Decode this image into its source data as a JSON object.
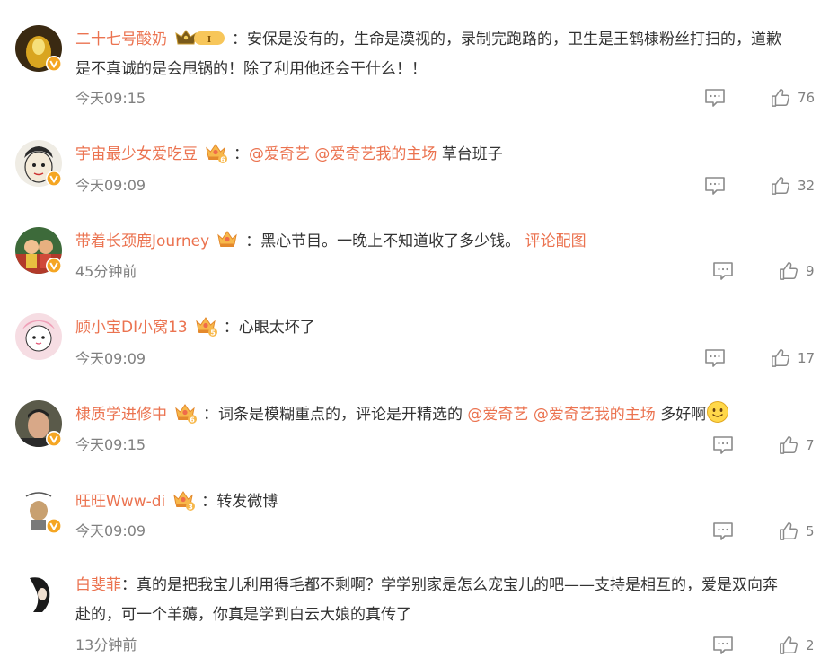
{
  "comments": [
    {
      "username": "二十七号酸奶",
      "separator": "：",
      "text": "安保是没有的，生命是漠视的，录制完跑路的，卫生是王鹤棣粉丝打扫的，道歉是不真诚的是会甩锅的！除了利用他还会干什么！！",
      "line1": "安保是没有的，生命是漠视的，录制完跑路的，卫生是王鹤棣粉丝打扫的，道歉",
      "line2": "是不真诚的是会甩锅的！除了利用他还会干什么！！",
      "time": "今天09:15",
      "likes": "76",
      "medal_level": "I"
    },
    {
      "username": "宇宙最少女爱吃豆",
      "separator": "：",
      "mentions": [
        "@爱奇艺",
        "@爱奇艺我的主场"
      ],
      "text": "草台班子",
      "time": "今天09:09",
      "likes": "32",
      "medal_level": "6"
    },
    {
      "username": "带着长颈鹿Journey",
      "separator": "：",
      "text": "黑心节目。一晚上不知道收了多少钱。",
      "picture_link": "评论配图",
      "time": "45分钟前",
      "likes": "9"
    },
    {
      "username": "顾小宝DI小窝13",
      "separator": "：",
      "text": "心眼太坏了",
      "time": "今天09:09",
      "likes": "17",
      "medal_level": "5"
    },
    {
      "username": "棣质学进修中",
      "separator": "：",
      "text": "词条是模糊重点的，评论是开精选的",
      "mentions": [
        "@爱奇艺",
        "@爱奇艺我的主场"
      ],
      "text_after": "多好啊",
      "emoji": "smile-emoji",
      "time": "今天09:15",
      "likes": "7",
      "medal_level": "6"
    },
    {
      "username": "旺旺Www-di",
      "separator": "：",
      "text": "转发微博",
      "time": "今天09:09",
      "likes": "5",
      "medal_level": "3"
    },
    {
      "username": "白斐菲",
      "separator": "：",
      "text": "真的是把我宝儿利用得毛都不剩啊？学学别家是怎么宠宝儿的吧——支持是相互的，爱是双向奔赴的，可一个羊薅，你真是学到白云大娘的真传了",
      "line1": "真的是把我宝儿利用得毛都不剩啊？学学别家是怎么宠宝儿的吧——支持是相互的，爱是双向奔",
      "line2": "赴的，可一个羊薅，你真是学到白云大娘的真传了",
      "time": "13分钟前",
      "likes": "2"
    }
  ],
  "colors": {
    "username": "#eb7350",
    "text": "#333333",
    "meta": "#808080",
    "verified_badge": "#f5a623"
  },
  "icons": {
    "comment": "comment-icon",
    "like": "thumbs-up-icon",
    "verified": "verified-badge-icon",
    "medal": "fan-medal-icon"
  }
}
